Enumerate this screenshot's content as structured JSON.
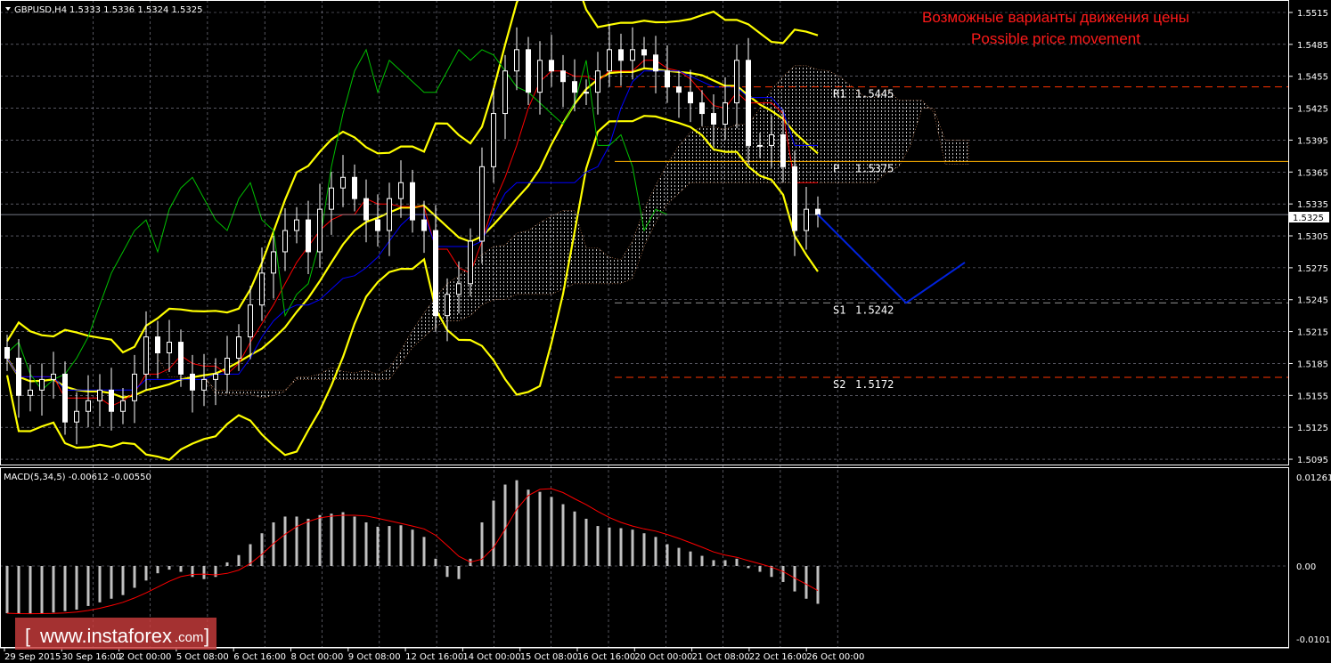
{
  "header": {
    "symbol": "GBPUSD,H4",
    "ohlc": "1.5333 1.5336 1.5324 1.5325"
  },
  "title": {
    "ru": "Возможные варианты движения цены",
    "en": "Possible price movement"
  },
  "watermark": {
    "left": "[",
    "text": "www.instaforex",
    "suffix": ".com",
    "right": "]"
  },
  "colors": {
    "background": "#000000",
    "grid": "#8a8a9a",
    "bollinger": "#ffff00",
    "tenkan": "#ff0000",
    "kijun": "#0000ff",
    "chikou": "#00c000",
    "resistance": "#ff3300",
    "pivot": "#ffb000",
    "support": "#909090",
    "forecast": "#0022dd",
    "macd_hist": "#c0c0c0",
    "macd_signal": "#ff0000"
  },
  "levels": [
    {
      "label": "R1",
      "value": "1.5445",
      "price": 1.5445,
      "style": "dashed",
      "color": "#ff3300"
    },
    {
      "label": "P",
      "value": "1.5375",
      "price": 1.5375,
      "style": "solid",
      "color": "#ffb000"
    },
    {
      "label": "S1",
      "value": "1.5242",
      "price": 1.5242,
      "style": "dashed",
      "color": "#909090"
    },
    {
      "label": "S2",
      "value": "1.5172",
      "price": 1.5172,
      "style": "dashed",
      "color": "#ff3300"
    }
  ],
  "current_price": "1.5325",
  "chart_data": [
    {
      "type": "candlestick",
      "title": "GBPUSD,H4",
      "ylim": [
        1.508,
        1.5535
      ],
      "yticks": [
        "1.5515",
        "1.5485",
        "1.5455",
        "1.5425",
        "1.5395",
        "1.5365",
        "1.5335",
        "1.5305",
        "1.5275",
        "1.5245",
        "1.5215",
        "1.5185",
        "1.5155",
        "1.5125",
        "1.5095"
      ],
      "xticks": [
        "29 Sep 2015",
        "30 Sep 16:00",
        "2 Oct 00:00",
        "5 Oct 08:00",
        "6 Oct 16:00",
        "8 Oct 00:00",
        "9 Oct 08:00",
        "12 Oct 16:00",
        "14 Oct 00:00",
        "15 Oct 08:00",
        "16 Oct 16:00",
        "20 Oct 00:00",
        "21 Oct 08:00",
        "22 Oct 16:00",
        "26 Oct 00:00"
      ],
      "closes": [
        1.519,
        1.5155,
        1.516,
        1.517,
        1.5175,
        1.513,
        1.514,
        1.515,
        1.516,
        1.514,
        1.515,
        1.5175,
        1.521,
        1.5195,
        1.5205,
        1.5175,
        1.516,
        1.517,
        1.5175,
        1.519,
        1.521,
        1.524,
        1.527,
        1.529,
        1.531,
        1.532,
        1.529,
        1.533,
        1.535,
        1.536,
        1.534,
        1.532,
        1.531,
        1.534,
        1.5355,
        1.532,
        1.531,
        1.523,
        1.525,
        1.526,
        1.53,
        1.537,
        1.542,
        1.546,
        1.548,
        1.544,
        1.547,
        1.546,
        1.545,
        1.544,
        1.544,
        1.546,
        1.548,
        1.547,
        1.548,
        1.5475,
        1.546,
        1.5445,
        1.544,
        1.543,
        1.542,
        1.541,
        1.543,
        1.547,
        1.539,
        1.539,
        1.54,
        1.537,
        1.531,
        1.533,
        1.5325
      ],
      "forecast": [
        1.5325,
        1.5242,
        1.528
      ]
    },
    {
      "type": "bar",
      "title": "MACD(5,34,5) -0.00612 -0.00550",
      "ylim": [
        -0.01011,
        0.01261
      ],
      "yticks": [
        "0.01261",
        "0.00",
        "-0.01011"
      ],
      "values": [
        -0.0065,
        -0.0066,
        -0.0066,
        -0.0065,
        -0.0064,
        -0.0062,
        -0.006,
        -0.0055,
        -0.005,
        -0.0045,
        -0.004,
        -0.003,
        -0.002,
        -0.001,
        -0.0005,
        -0.0008,
        -0.0015,
        -0.0018,
        -0.0015,
        0.0005,
        0.0015,
        0.003,
        0.0045,
        0.006,
        0.0068,
        0.0068,
        0.0065,
        0.007,
        0.0072,
        0.0074,
        0.0068,
        0.006,
        0.0054,
        0.0055,
        0.0056,
        0.005,
        0.004,
        0.001,
        -0.0015,
        -0.0018,
        0.001,
        0.006,
        0.009,
        0.0112,
        0.0118,
        0.0105,
        0.0102,
        0.0095,
        0.0085,
        0.0075,
        0.0065,
        0.0055,
        0.0053,
        0.0052,
        0.005,
        0.0045,
        0.004,
        0.003,
        0.0025,
        0.002,
        0.0014,
        0.0008,
        0.0008,
        0.001,
        -0.0003,
        -0.0008,
        -0.0015,
        -0.0022,
        -0.0035,
        -0.0045,
        -0.0052
      ]
    }
  ]
}
